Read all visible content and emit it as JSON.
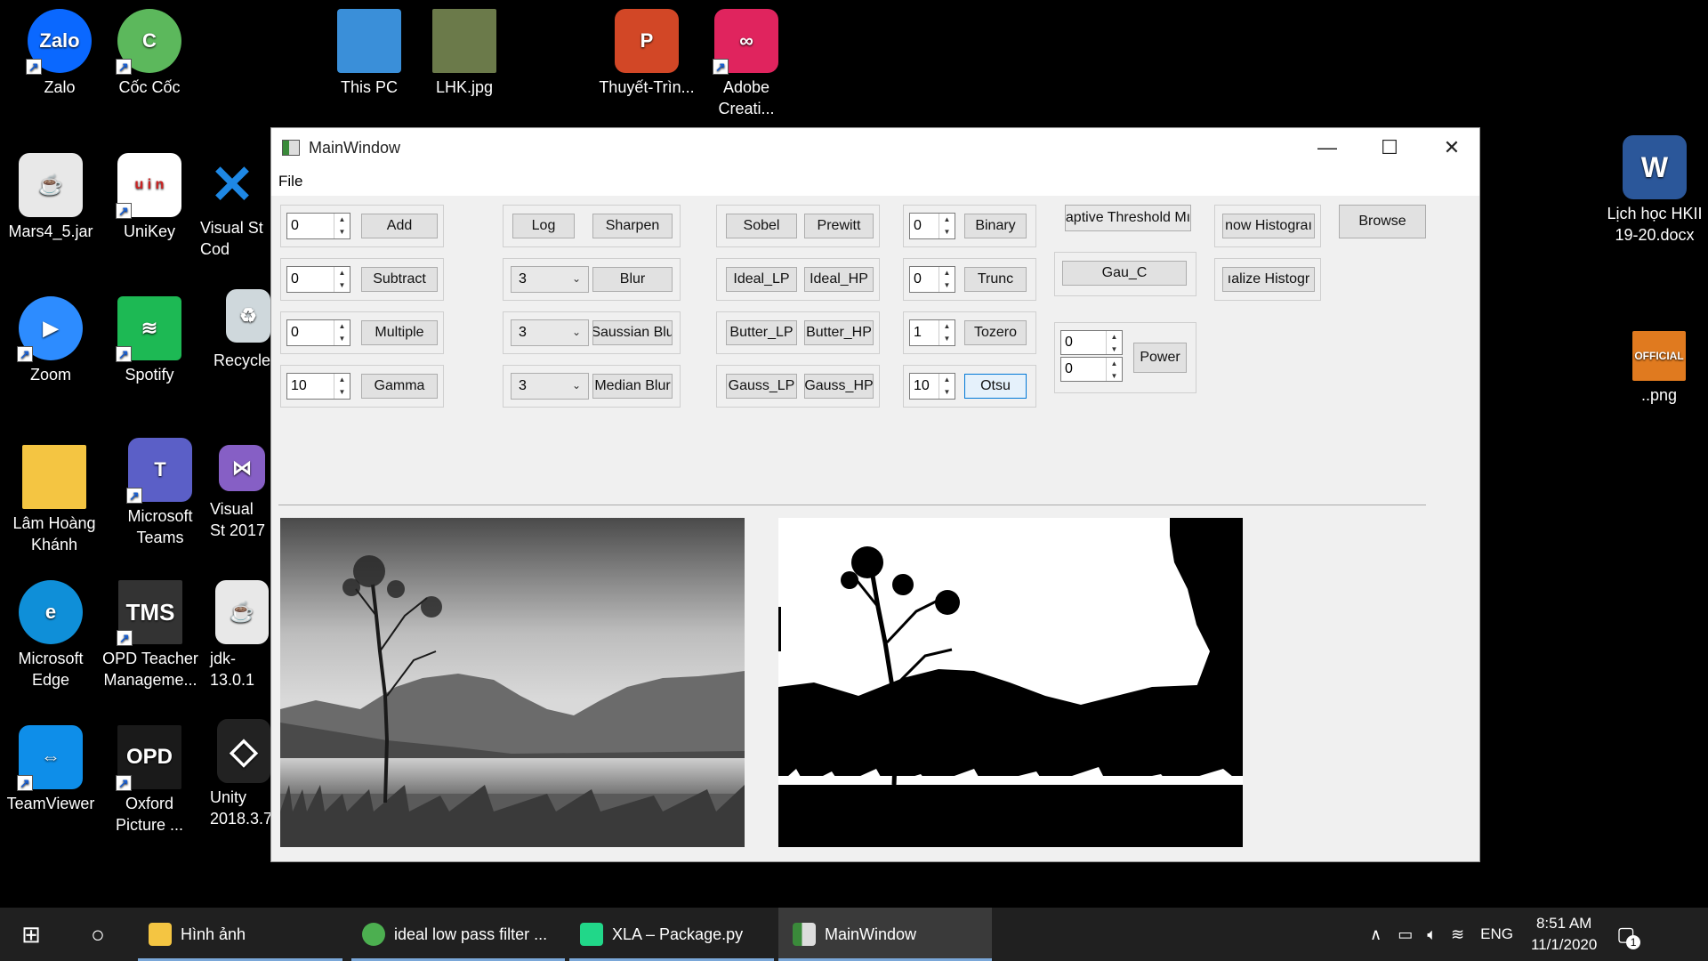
{
  "desktop": {
    "icons": [
      {
        "label": "Zalo",
        "color": "#0a68ff"
      },
      {
        "label": "Cốc Cốc",
        "color": "#5cb85c"
      },
      {
        "label": "This PC",
        "color": "#3a8fd9"
      },
      {
        "label": "LHK.jpg",
        "color": "#6b7a4a"
      },
      {
        "label": "Thuyết-Trìn...",
        "color": "#d24726"
      },
      {
        "label": "Adobe Creati...",
        "color": "#e0245e"
      },
      {
        "label": "Mars4_5.jar",
        "color": "#e8e8e8"
      },
      {
        "label": "UniKey",
        "color": "#ffffff"
      },
      {
        "label": "Visual St Cod",
        "color": "#1e88e5"
      },
      {
        "label": "Zoom",
        "color": "#2d8cff"
      },
      {
        "label": "Spotify",
        "color": "#1db954"
      },
      {
        "label": "Recycle",
        "color": "#cfd8dc"
      },
      {
        "label": "Lâm Hoàng Khánh",
        "color": "#f4c542"
      },
      {
        "label": "Microsoft Teams",
        "color": "#5b5fc7"
      },
      {
        "label": "Visual St 2017",
        "color": "#865fc5"
      },
      {
        "label": "Microsoft Edge",
        "color": "#0f8fd8"
      },
      {
        "label": "OPD Teacher Manageme...",
        "color": "#333333"
      },
      {
        "label": "jdk-13.0.1",
        "color": "#e8e8e8"
      },
      {
        "label": "TeamViewer",
        "color": "#0e8ee9"
      },
      {
        "label": "Oxford Picture ...",
        "color": "#1a1a1a"
      },
      {
        "label": "Unity 2018.3.7",
        "color": "#222222"
      },
      {
        "label": "Lịch học HKII 19-20.docx",
        "color": "#2b579a"
      },
      {
        "label": "..png",
        "color": "#e07a1f"
      }
    ]
  },
  "window": {
    "title": "MainWindow",
    "menu": [
      "File"
    ],
    "controls": {
      "minimize": "—",
      "maximize": "☐",
      "close": "✕"
    },
    "arith": {
      "spins": [
        "0",
        "0",
        "0",
        "10"
      ],
      "buttons": [
        "Add",
        "Subtract",
        "Multiple",
        "Gamma"
      ]
    },
    "filters": {
      "log": "Log",
      "sharpen": "Sharpen",
      "combos": [
        "3",
        "3",
        "3"
      ],
      "buttons": [
        "Blur",
        "Saussian Blu",
        "Median Blur"
      ]
    },
    "edges": {
      "buttons": [
        "Sobel",
        "Prewitt",
        "Ideal_LP",
        "Ideal_HP",
        "Butter_LP",
        "Butter_HP",
        "Gauss_LP",
        "Gauss_HP"
      ]
    },
    "thresh": {
      "spins": [
        "0",
        "0",
        "1",
        "10"
      ],
      "buttons": [
        "Binary",
        "Trunc",
        "Tozero",
        "Otsu"
      ]
    },
    "adaptive": {
      "button": "aptive Threshold Mı",
      "gau": "Gau_C"
    },
    "power": {
      "spins": [
        "0",
        "0"
      ],
      "button": "Power"
    },
    "hist": {
      "show": "now Histograı",
      "equalize": "ıalize Histogr"
    },
    "browse": "Browse"
  },
  "taskbar": {
    "items": [
      "Hình ảnh",
      "ideal low pass filter ...",
      "XLA – Package.py",
      "MainWindow"
    ],
    "lang": "ENG",
    "time": "8:51 AM",
    "date": "11/1/2020",
    "notif_count": "1"
  }
}
